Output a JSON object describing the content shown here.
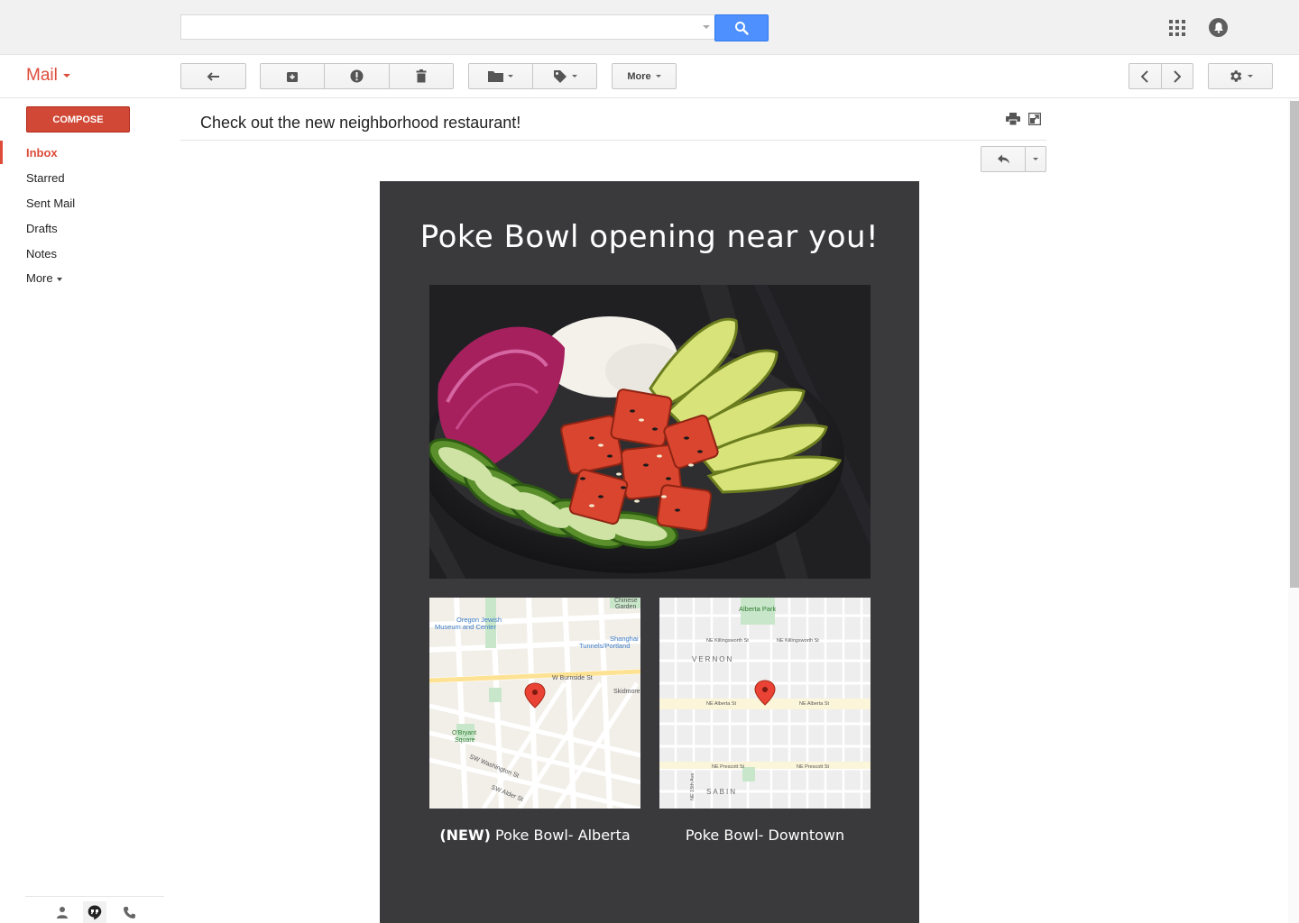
{
  "search": {
    "value": "",
    "placeholder": ""
  },
  "header": {
    "app_name": "Mail"
  },
  "toolbar": {
    "more_label": "More"
  },
  "sidebar": {
    "compose_label": "COMPOSE",
    "items": [
      {
        "label": "Inbox"
      },
      {
        "label": "Starred"
      },
      {
        "label": "Sent Mail"
      },
      {
        "label": "Drafts"
      },
      {
        "label": "Notes"
      },
      {
        "label": "More"
      }
    ]
  },
  "message": {
    "subject": "Check out the new neighborhood restaurant!",
    "heading": "Poke Bowl opening near you!",
    "maps": [
      {
        "tag": "(NEW)",
        "caption": " Poke Bowl- Alberta",
        "labels": [
          "Oregon Jewish",
          "Museum and Center",
          "Shanghai",
          "Tunnels/Portland",
          "W Burnside St",
          "O'Bryant",
          "Square",
          "SW Washington St",
          "SW Alder St",
          "Chinese",
          "Garden",
          "Skidmore"
        ]
      },
      {
        "tag": "",
        "caption": "Poke Bowl- Downtown",
        "labels": [
          "Alberta Park",
          "NE Killingsworth St",
          "VERNON",
          "NE Alberta St",
          "NE Prescott St",
          "SABIN",
          "NE 15th Ave"
        ]
      }
    ]
  },
  "colors": {
    "brand_red": "#dd4b39",
    "compose_red": "#d14836",
    "search_blue": "#4d90fe",
    "email_background": "#3a3a3c",
    "map_pin": "#ea4335"
  }
}
